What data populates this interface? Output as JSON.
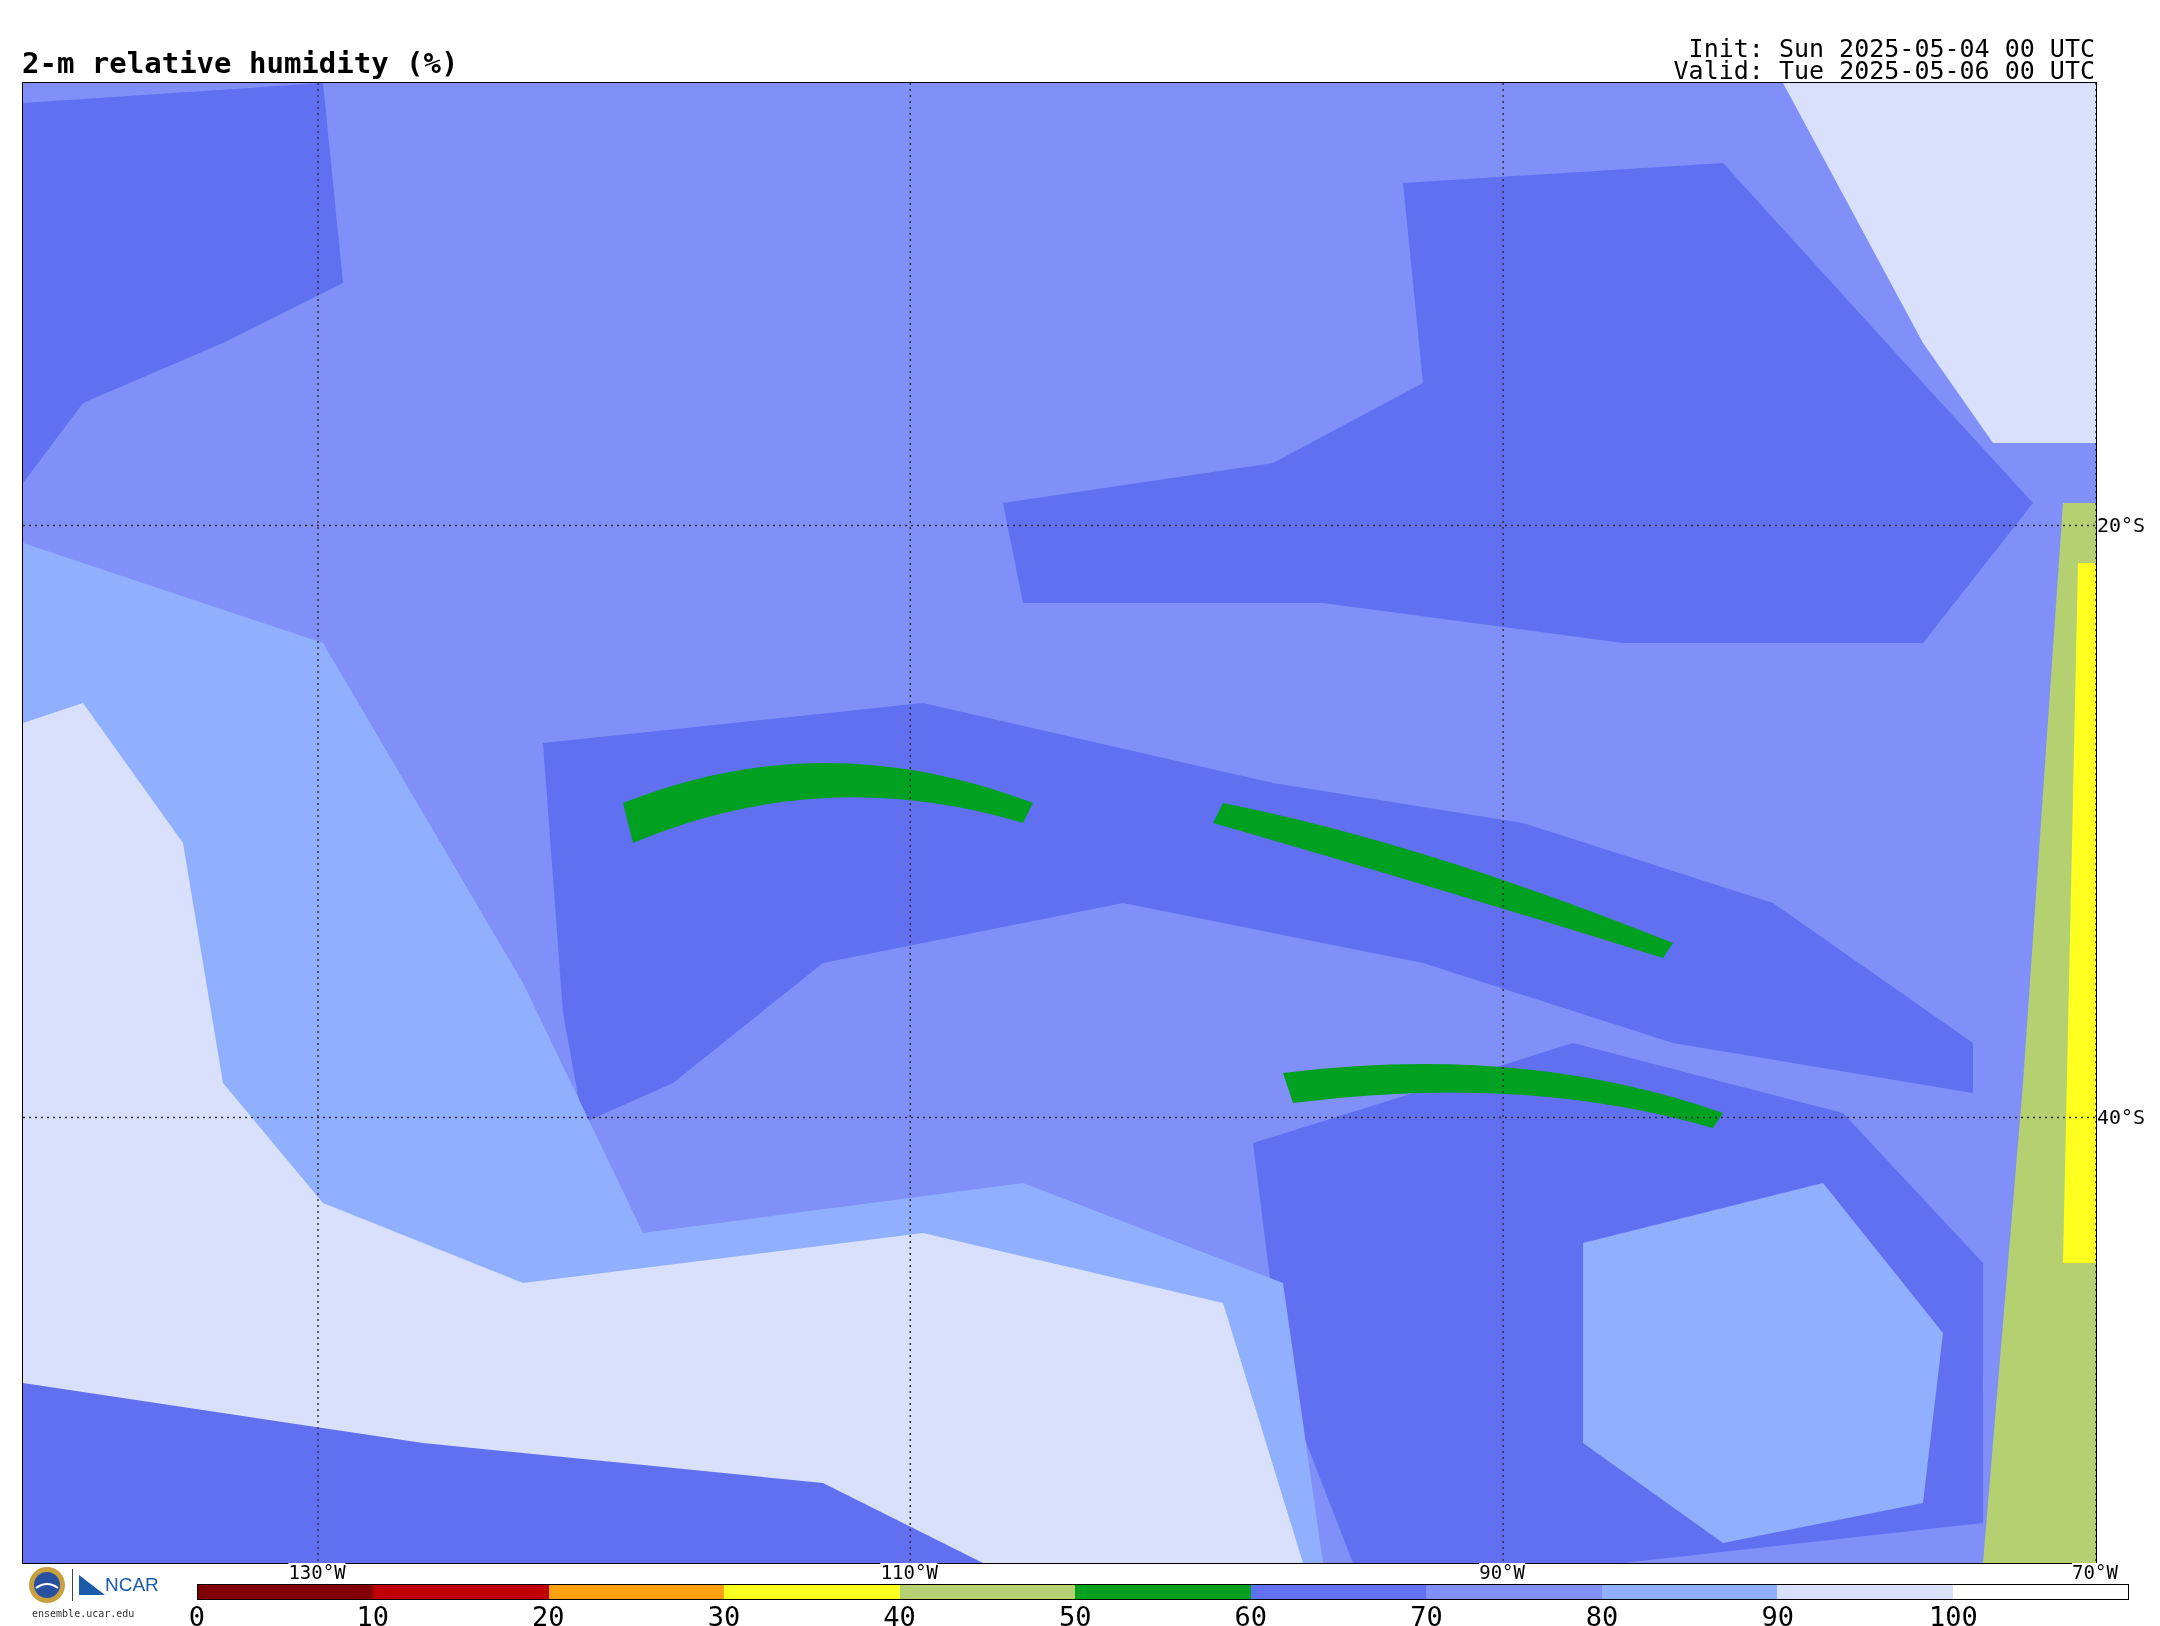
{
  "title": "2-m relative humidity (%)",
  "init": "Init: Sun 2025-05-04 00 UTC",
  "valid": "Valid: Tue 2025-05-06 00 UTC",
  "map": {
    "longitude_labels": [
      "130°W",
      "110°W",
      "90°W",
      "70°W"
    ],
    "latitude_labels": [
      "20°S",
      "40°S"
    ]
  },
  "logos": {
    "ncar": "NCAR",
    "url": "ensemble.ucar.edu"
  },
  "colorbar": [
    {
      "color": "#800000",
      "label": "0"
    },
    {
      "color": "#c00000",
      "label": "10"
    },
    {
      "color": "#ffa010",
      "label": "20"
    },
    {
      "color": "#ffff20",
      "label": "30"
    },
    {
      "color": "#b4d070",
      "label": "40"
    },
    {
      "color": "#00a020",
      "label": "50"
    },
    {
      "color": "#6070f0",
      "label": "60"
    },
    {
      "color": "#8090f8",
      "label": "70"
    },
    {
      "color": "#90b0ff",
      "label": "80"
    },
    {
      "color": "#d8e0fc",
      "label": "90"
    },
    {
      "color": "#ffffff",
      "label": "100"
    }
  ]
}
